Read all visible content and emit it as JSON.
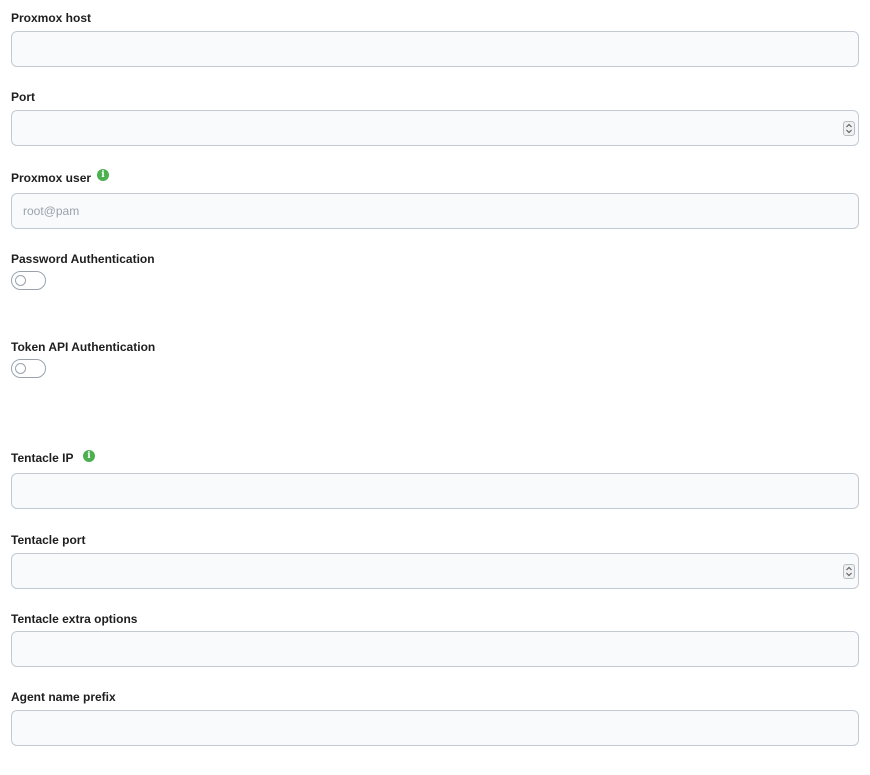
{
  "form": {
    "proxmox_host": {
      "label": "Proxmox host",
      "value": "",
      "placeholder": ""
    },
    "port": {
      "label": "Port",
      "value": "",
      "placeholder": ""
    },
    "proxmox_user": {
      "label": "Proxmox user",
      "value": "",
      "placeholder": "root@pam",
      "info_icon": "info-icon"
    },
    "password_auth": {
      "label": "Password Authentication",
      "enabled": false
    },
    "token_auth": {
      "label": "Token API Authentication",
      "enabled": false
    },
    "tentacle_ip": {
      "label": "Tentacle IP",
      "value": "",
      "placeholder": "",
      "info_icon": "info-icon"
    },
    "tentacle_port": {
      "label": "Tentacle port",
      "value": "",
      "placeholder": ""
    },
    "tentacle_extra_options": {
      "label": "Tentacle extra options",
      "value": "",
      "placeholder": ""
    },
    "agent_name_prefix": {
      "label": "Agent name prefix",
      "value": "",
      "placeholder": ""
    }
  },
  "colors": {
    "info_icon": "#4caf50",
    "field_border": "#c3cad4",
    "field_background": "#f8fafc"
  }
}
